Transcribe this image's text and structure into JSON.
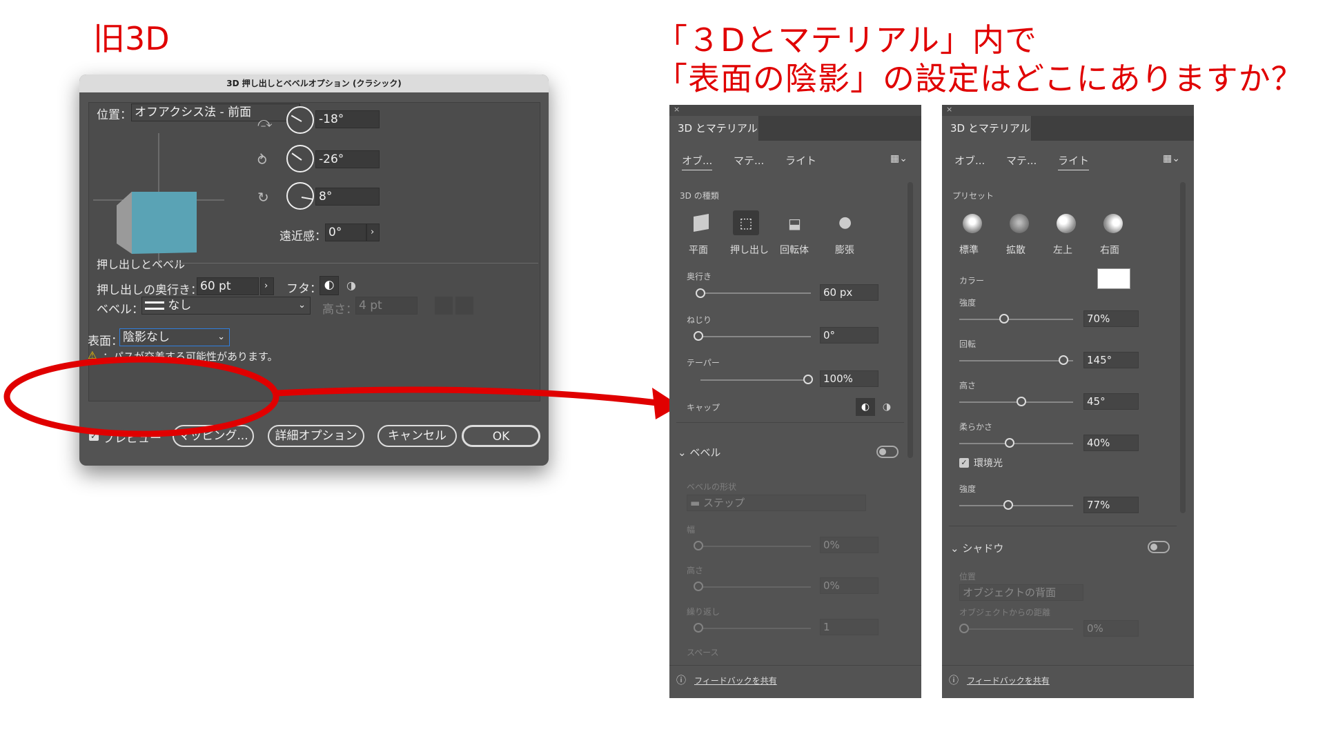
{
  "annotations": {
    "old_title": "旧3D",
    "question_line1": "「３Dとマテリアル」内で",
    "question_line2": "「表面の陰影」の設定はどこにありますか？"
  },
  "dialog": {
    "title": "3D 押し出しとベベルオプション (クラシック)",
    "position_label": "位置：",
    "position_value": "オフアクシス法 - 前面",
    "rot_x": "-18°",
    "rot_y": "-26°",
    "rot_z": "8°",
    "perspective_label": "遠近感：",
    "perspective_value": "0°",
    "extrude_section": "押し出しとベベル",
    "extrude_depth_label": "押し出しの奥行き：",
    "extrude_depth_value": "60 pt",
    "cap_label": "フタ：",
    "bevel_label": "ベベル：",
    "bevel_value": "なし",
    "height_label": "高さ：",
    "height_value": "4 pt",
    "surface_label": "表面：",
    "surface_value": "陰影なし",
    "warning": "：パスが交差する可能性があります。",
    "preview_label": "プレビュー",
    "mapping_button": "マッピング...",
    "more_options_button": "詳細オプション",
    "cancel_button": "キャンセル",
    "ok_button": "OK",
    "colors": {
      "cube_front": "#5aa3b5",
      "cube_top": "#d9d9d9",
      "cube_side": "#9a9a9a",
      "annotation_red": "#e00000"
    }
  },
  "panel_object": {
    "title": "3D とマテリアル",
    "tabs": [
      "オブ...",
      "マテ...",
      "ライト"
    ],
    "active_tab": 0,
    "type_header": "3D の種類",
    "types": [
      "平面",
      "押し出し",
      "回転体",
      "膨張"
    ],
    "active_type": 1,
    "depth_label": "奥行き",
    "depth_value": "60 px",
    "twist_label": "ねじり",
    "twist_value": "0°",
    "taper_label": "テーパー",
    "taper_value": "100%",
    "cap_label": "キャップ",
    "bevel_section": "ベベル",
    "bevel_shape_label": "ベベルの形状",
    "bevel_shape_value": "ステップ",
    "width_label": "幅",
    "width_value": "0%",
    "height_label": "高さ",
    "height_value": "0%",
    "repeat_label": "繰り返し",
    "repeat_value": "1",
    "space_label": "スペース",
    "feedback": "フィードバックを共有"
  },
  "panel_light": {
    "title": "3D とマテリアル",
    "tabs": [
      "オブ...",
      "マテ...",
      "ライト"
    ],
    "active_tab": 2,
    "preset_header": "プリセット",
    "presets": [
      "標準",
      "拡散",
      "左上",
      "右面"
    ],
    "color_label": "カラー",
    "intensity_label": "強度",
    "intensity_value": "70%",
    "rotation_label": "回転",
    "rotation_value": "145°",
    "height_label": "高さ",
    "height_value": "45°",
    "softness_label": "柔らかさ",
    "softness_value": "40%",
    "ambient_label": "環境光",
    "ambient_intensity_label": "強度",
    "ambient_intensity_value": "77%",
    "shadow_section": "シャドウ",
    "shadow_position_label": "位置",
    "shadow_position_value": "オブジェクトの背面",
    "shadow_distance_label": "オブジェクトからの距離",
    "shadow_distance_value": "0%",
    "feedback": "フィードバックを共有"
  }
}
